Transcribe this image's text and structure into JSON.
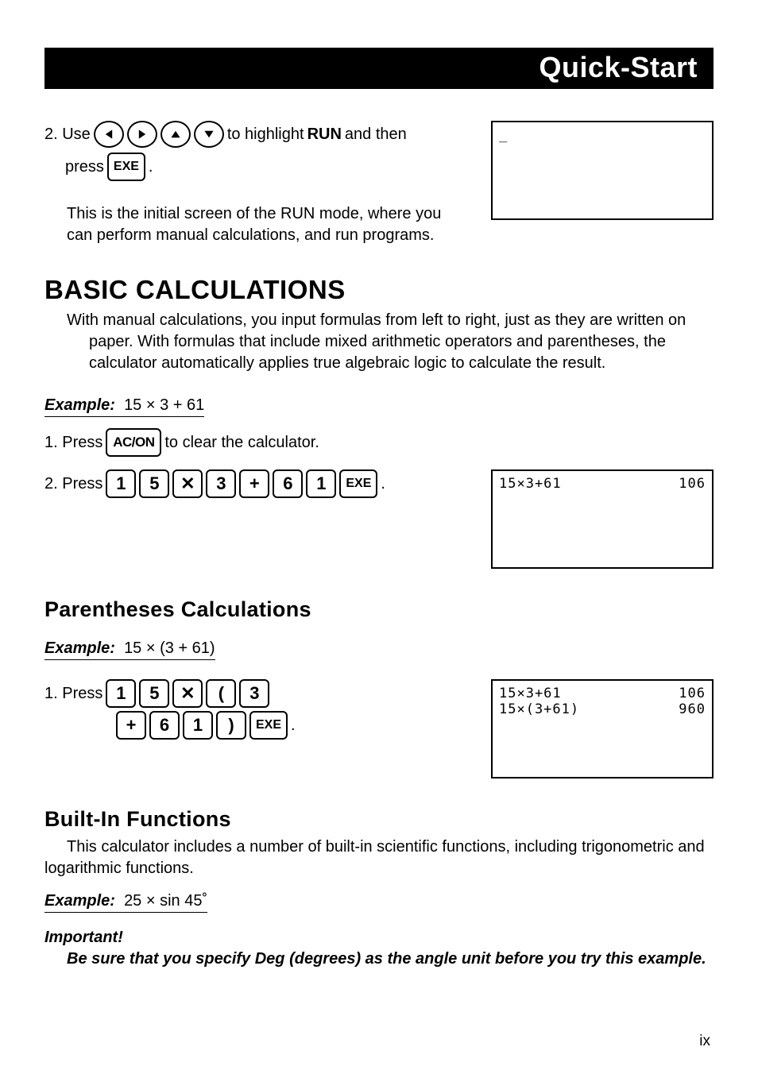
{
  "banner": "Quick-Start",
  "step2": {
    "prefix": "2. Use",
    "mid": "to highlight",
    "bold": "RUN",
    "mid2": "and then",
    "press": "press",
    "period": "."
  },
  "step2_desc": "This is the initial screen of the RUN mode, where you can perform manual calculations, and run programs.",
  "screen1": {
    "cursor": "_"
  },
  "h1_basic": "BASIC CALCULATIONS",
  "basic_para": "With manual calculations, you input formulas from left to right, just as they are written on paper. With formulas that include mixed arithmetic operators and parentheses, the calculator automatically applies true algebraic logic to calculate the result.",
  "example1_label": "Example:",
  "example1_expr": "15 × 3 + 61",
  "basic_step1_prefix": "1.  Press",
  "basic_step1_suffix": "to clear the calculator.",
  "basic_step2_prefix": "2. Press",
  "screen2": {
    "l1_left": "15×3+61",
    "l1_right": "106"
  },
  "h2_paren": "Parentheses Calculations",
  "example2_label": "Example:",
  "example2_expr": "15 × (3 + 61)",
  "paren_step1_prefix": "1. Press",
  "screen3": {
    "l1_left": "15×3+61",
    "l1_right": "106",
    "l2_left": "15×(3+61)",
    "l2_right": "960"
  },
  "h2_builtin": "Built-In Functions",
  "builtin_para": "This calculator includes a number of built-in scientific functions, including trigonometric and logarithmic functions.",
  "example3_label": "Example:",
  "example3_expr": "25 × sin 45˚",
  "important_label": "Important!",
  "important_text": "Be sure that you specify Deg (degrees) as the angle unit before you try this example.",
  "keys": {
    "exe": "EXE",
    "ac_on": "AC/ON",
    "d1": "1",
    "d5": "5",
    "d3": "3",
    "d6": "6",
    "times": "✕",
    "plus": "+",
    "lparen": "(",
    "rparen": ")"
  },
  "page_num": "ix"
}
